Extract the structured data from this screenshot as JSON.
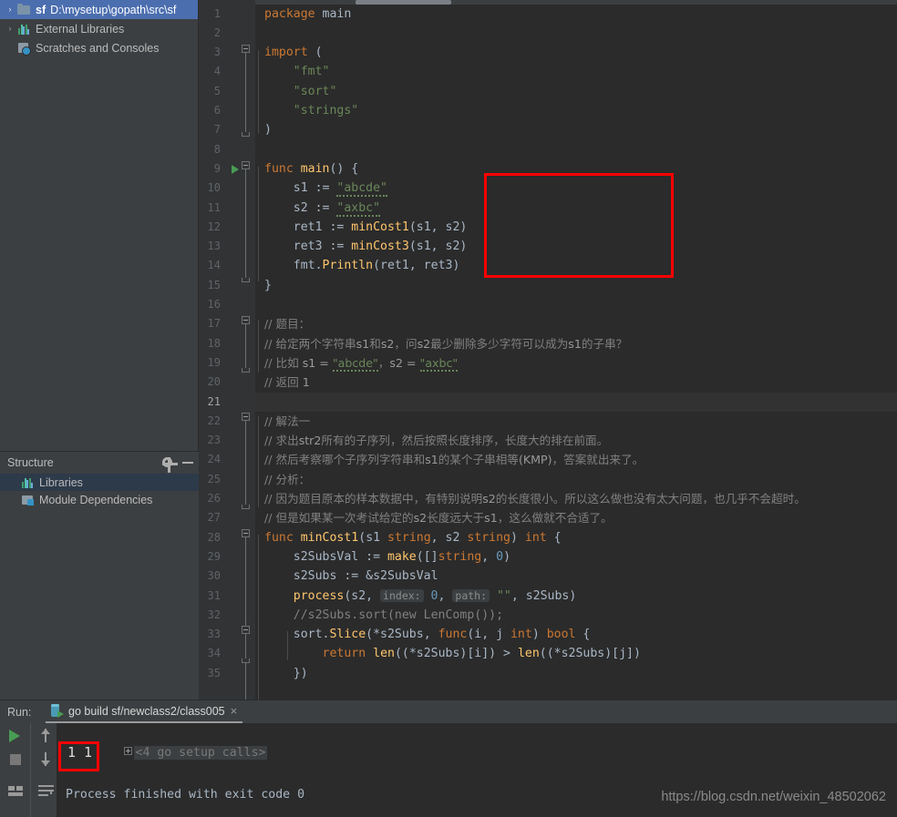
{
  "project_tree": {
    "items": [
      {
        "arrow": "›",
        "icon": "folder-icon",
        "name_bold": "sf",
        "path": "D:\\mysetup\\gopath\\src\\sf",
        "selected": true
      },
      {
        "arrow": "›",
        "icon": "library-bars-icon",
        "name_bold": "",
        "path": "External Libraries",
        "selected": false
      },
      {
        "arrow": "",
        "icon": "scratches-icon",
        "name_bold": "",
        "path": "Scratches and Consoles",
        "selected": false
      }
    ]
  },
  "structure": {
    "title": "Structure",
    "gear_icon": "gear-icon",
    "minimize_icon": "minimize-icon",
    "items": [
      {
        "icon": "library-bars-icon",
        "label": "Libraries",
        "selected": true
      },
      {
        "icon": "module-dependencies-icon",
        "label": "Module Dependencies",
        "selected": false
      }
    ]
  },
  "editor": {
    "first_line": 1,
    "last_line": 35,
    "current_line": 21,
    "run_marker_line": 9,
    "lines": [
      {
        "n": 1,
        "html": "<span class=\"kw\">package</span> <span class=\"pln\">main</span>"
      },
      {
        "n": 2,
        "html": ""
      },
      {
        "n": 3,
        "html": "<span class=\"kw\">import</span> <span class=\"pln\">(</span>"
      },
      {
        "n": 4,
        "html": "    <span class=\"str\">\"fmt\"</span>"
      },
      {
        "n": 5,
        "html": "    <span class=\"str\">\"sort\"</span>"
      },
      {
        "n": 6,
        "html": "    <span class=\"str\">\"strings\"</span>"
      },
      {
        "n": 7,
        "html": "<span class=\"pln\">)</span>"
      },
      {
        "n": 8,
        "html": ""
      },
      {
        "n": 9,
        "html": "<span class=\"kw\">func</span> <span class=\"fn\">main</span><span class=\"pln\">() {</span>"
      },
      {
        "n": 10,
        "html": "    <span class=\"pln\">s1 := </span><span class=\"str squig\">\"abcde\"</span>"
      },
      {
        "n": 11,
        "html": "    <span class=\"pln\">s2 := </span><span class=\"str squig\">\"axbc\"</span>"
      },
      {
        "n": 12,
        "html": "    <span class=\"pln\">ret1 := </span><span class=\"fn\">minCost1</span><span class=\"pln\">(s1, s2)</span>"
      },
      {
        "n": 13,
        "html": "    <span class=\"pln\">ret3 := </span><span class=\"fn\">minCost3</span><span class=\"pln\">(s1, s2)</span>"
      },
      {
        "n": 14,
        "html": "    <span class=\"pln\">fmt.</span><span class=\"fn\">Println</span><span class=\"pln\">(ret1, ret3)</span>"
      },
      {
        "n": 15,
        "html": "<span class=\"pln\">}</span>"
      },
      {
        "n": 16,
        "html": ""
      },
      {
        "n": 17,
        "html": "<span class=\"comcn\">// 题目：</span>"
      },
      {
        "n": 18,
        "html": "<span class=\"comcn\">// 给定两个字符串<span class=\"cd\">s1</span>和<span class=\"cd\">s2</span>，问<span class=\"cd\">s2</span>最少删除多少字符可以成为<span class=\"cd\">s1</span>的子串？</span>"
      },
      {
        "n": 19,
        "html": "<span class=\"comcn\">// 比如 <span class=\"cd\">s1 = <span class=\"str squig\">\"abcde\"</span></span>，<span class=\"cd\">s2 = <span class=\"str squig\">\"axbc\"</span></span></span>"
      },
      {
        "n": 20,
        "html": "<span class=\"comcn\">// 返回 <span class=\"cd\">1</span></span>"
      },
      {
        "n": 21,
        "html": ""
      },
      {
        "n": 22,
        "html": "<span class=\"comcn\">// 解法一</span>"
      },
      {
        "n": 23,
        "html": "<span class=\"comcn\">// 求出<span class=\"cd\">str2</span>所有的子序列，然后按照长度排序，长度大的排在前面。</span>"
      },
      {
        "n": 24,
        "html": "<span class=\"comcn\">// 然后考察哪个子序列字符串和<span class=\"cd\">s1</span>的某个子串相等<span class=\"cd\">(KMP)</span>，答案就出来了。</span>"
      },
      {
        "n": 25,
        "html": "<span class=\"comcn\">// 分析：</span>"
      },
      {
        "n": 26,
        "html": "<span class=\"comcn\">// 因为题目原本的样本数据中，有特别说明<span class=\"cd\">s2</span>的长度很小。所以这么做也没有太大问题，也几乎不会超时。</span>"
      },
      {
        "n": 27,
        "html": "<span class=\"comcn\">// 但是如果某一次考试给定的<span class=\"cd\">s2</span>长度远大于<span class=\"cd\">s1</span>，这么做就不合适了。</span>"
      },
      {
        "n": 28,
        "html": "<span class=\"kw\">func</span> <span class=\"fn\">minCost1</span><span class=\"pln\">(s1 </span><span class=\"kw\">string</span><span class=\"pln\">, s2 </span><span class=\"kw\">string</span><span class=\"pln\">) </span><span class=\"kw\">int</span><span class=\"pln\"> {</span>"
      },
      {
        "n": 29,
        "html": "    <span class=\"pln\">s2SubsVal := </span><span class=\"fn\">make</span><span class=\"pln\">([]</span><span class=\"kw\">string</span><span class=\"pln\">, </span><span class=\"num\">0</span><span class=\"pln\">)</span>"
      },
      {
        "n": 30,
        "html": "    <span class=\"pln\">s2Subs := &amp;s2SubsVal</span>"
      },
      {
        "n": 31,
        "html": "    <span class=\"fn\">process</span><span class=\"pln\">(s2, </span><span class=\"hint\">index:</span><span class=\"pln\"> </span><span class=\"num\">0</span><span class=\"pln\">, </span><span class=\"hint\">path:</span><span class=\"pln\"> </span><span class=\"str\">\"\"</span><span class=\"pln\">, s2Subs)</span>"
      },
      {
        "n": 32,
        "html": "    <span class=\"com\">//s2Subs.sort(new LenComp());</span>"
      },
      {
        "n": 33,
        "html": "    <span class=\"pln\">sort.</span><span class=\"fn\">Slice</span><span class=\"pln\">(*s2Subs, </span><span class=\"kw\">func</span><span class=\"pln\">(i, j </span><span class=\"kw\">int</span><span class=\"pln\">) </span><span class=\"kw\">bool</span><span class=\"pln\"> {</span>"
      },
      {
        "n": 34,
        "html": "        <span class=\"kw\">return</span> <span class=\"fn\">len</span><span class=\"pln\">((*s2Subs)[i]) &gt; </span><span class=\"fn\">len</span><span class=\"pln\">((*s2Subs)[j])</span>"
      },
      {
        "n": 35,
        "html": "    <span class=\"pln\">})</span>"
      }
    ],
    "highlight_box": {
      "label": "main-body-highlight"
    }
  },
  "run_panel": {
    "run_label": "Run:",
    "tab_title": "go build sf/newclass2/class005",
    "tab_close_glyph": "×",
    "toolbar": [
      {
        "name": "rerun-button",
        "icon": "play-icon"
      },
      {
        "name": "stop-button",
        "icon": "stop-icon"
      },
      {
        "name": "layout-button",
        "icon": "layout-icon"
      },
      {
        "name": "prev-occurrence-button",
        "icon": "arrow-up-icon"
      },
      {
        "name": "next-occurrence-button",
        "icon": "arrow-down-icon"
      },
      {
        "name": "soft-wrap-button",
        "icon": "wrap-icon"
      }
    ],
    "console": {
      "setup_calls": "<4 go setup calls>",
      "output": "1 1",
      "exit_message": "Process finished with exit code 0",
      "output_highlight": "output-highlight"
    }
  },
  "watermark": "https://blog.csdn.net/weixin_48502062",
  "colors": {
    "accent_selection": "#4b6eaf",
    "annotation_red": "#ff0000",
    "run_green": "#499c54",
    "editor_bg": "#2b2b2b",
    "panel_bg": "#3c3f41"
  }
}
